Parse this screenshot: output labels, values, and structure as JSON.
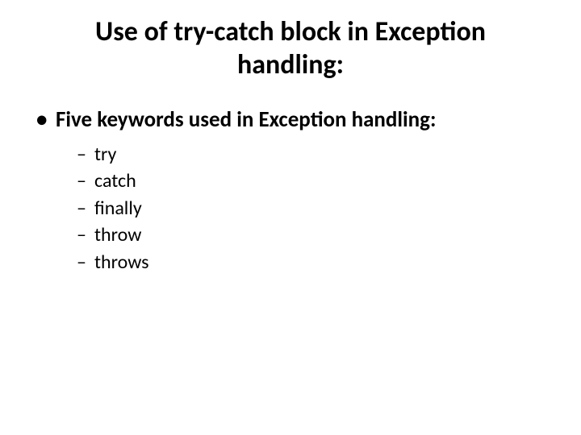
{
  "slide": {
    "title": "Use of try-catch block in Exception handling:",
    "bullets": {
      "main": "Five keywords used in Exception handling:",
      "sub": {
        "0": "try",
        "1": "catch",
        "2": "finally",
        "3": "throw",
        "4": "throws"
      }
    }
  }
}
